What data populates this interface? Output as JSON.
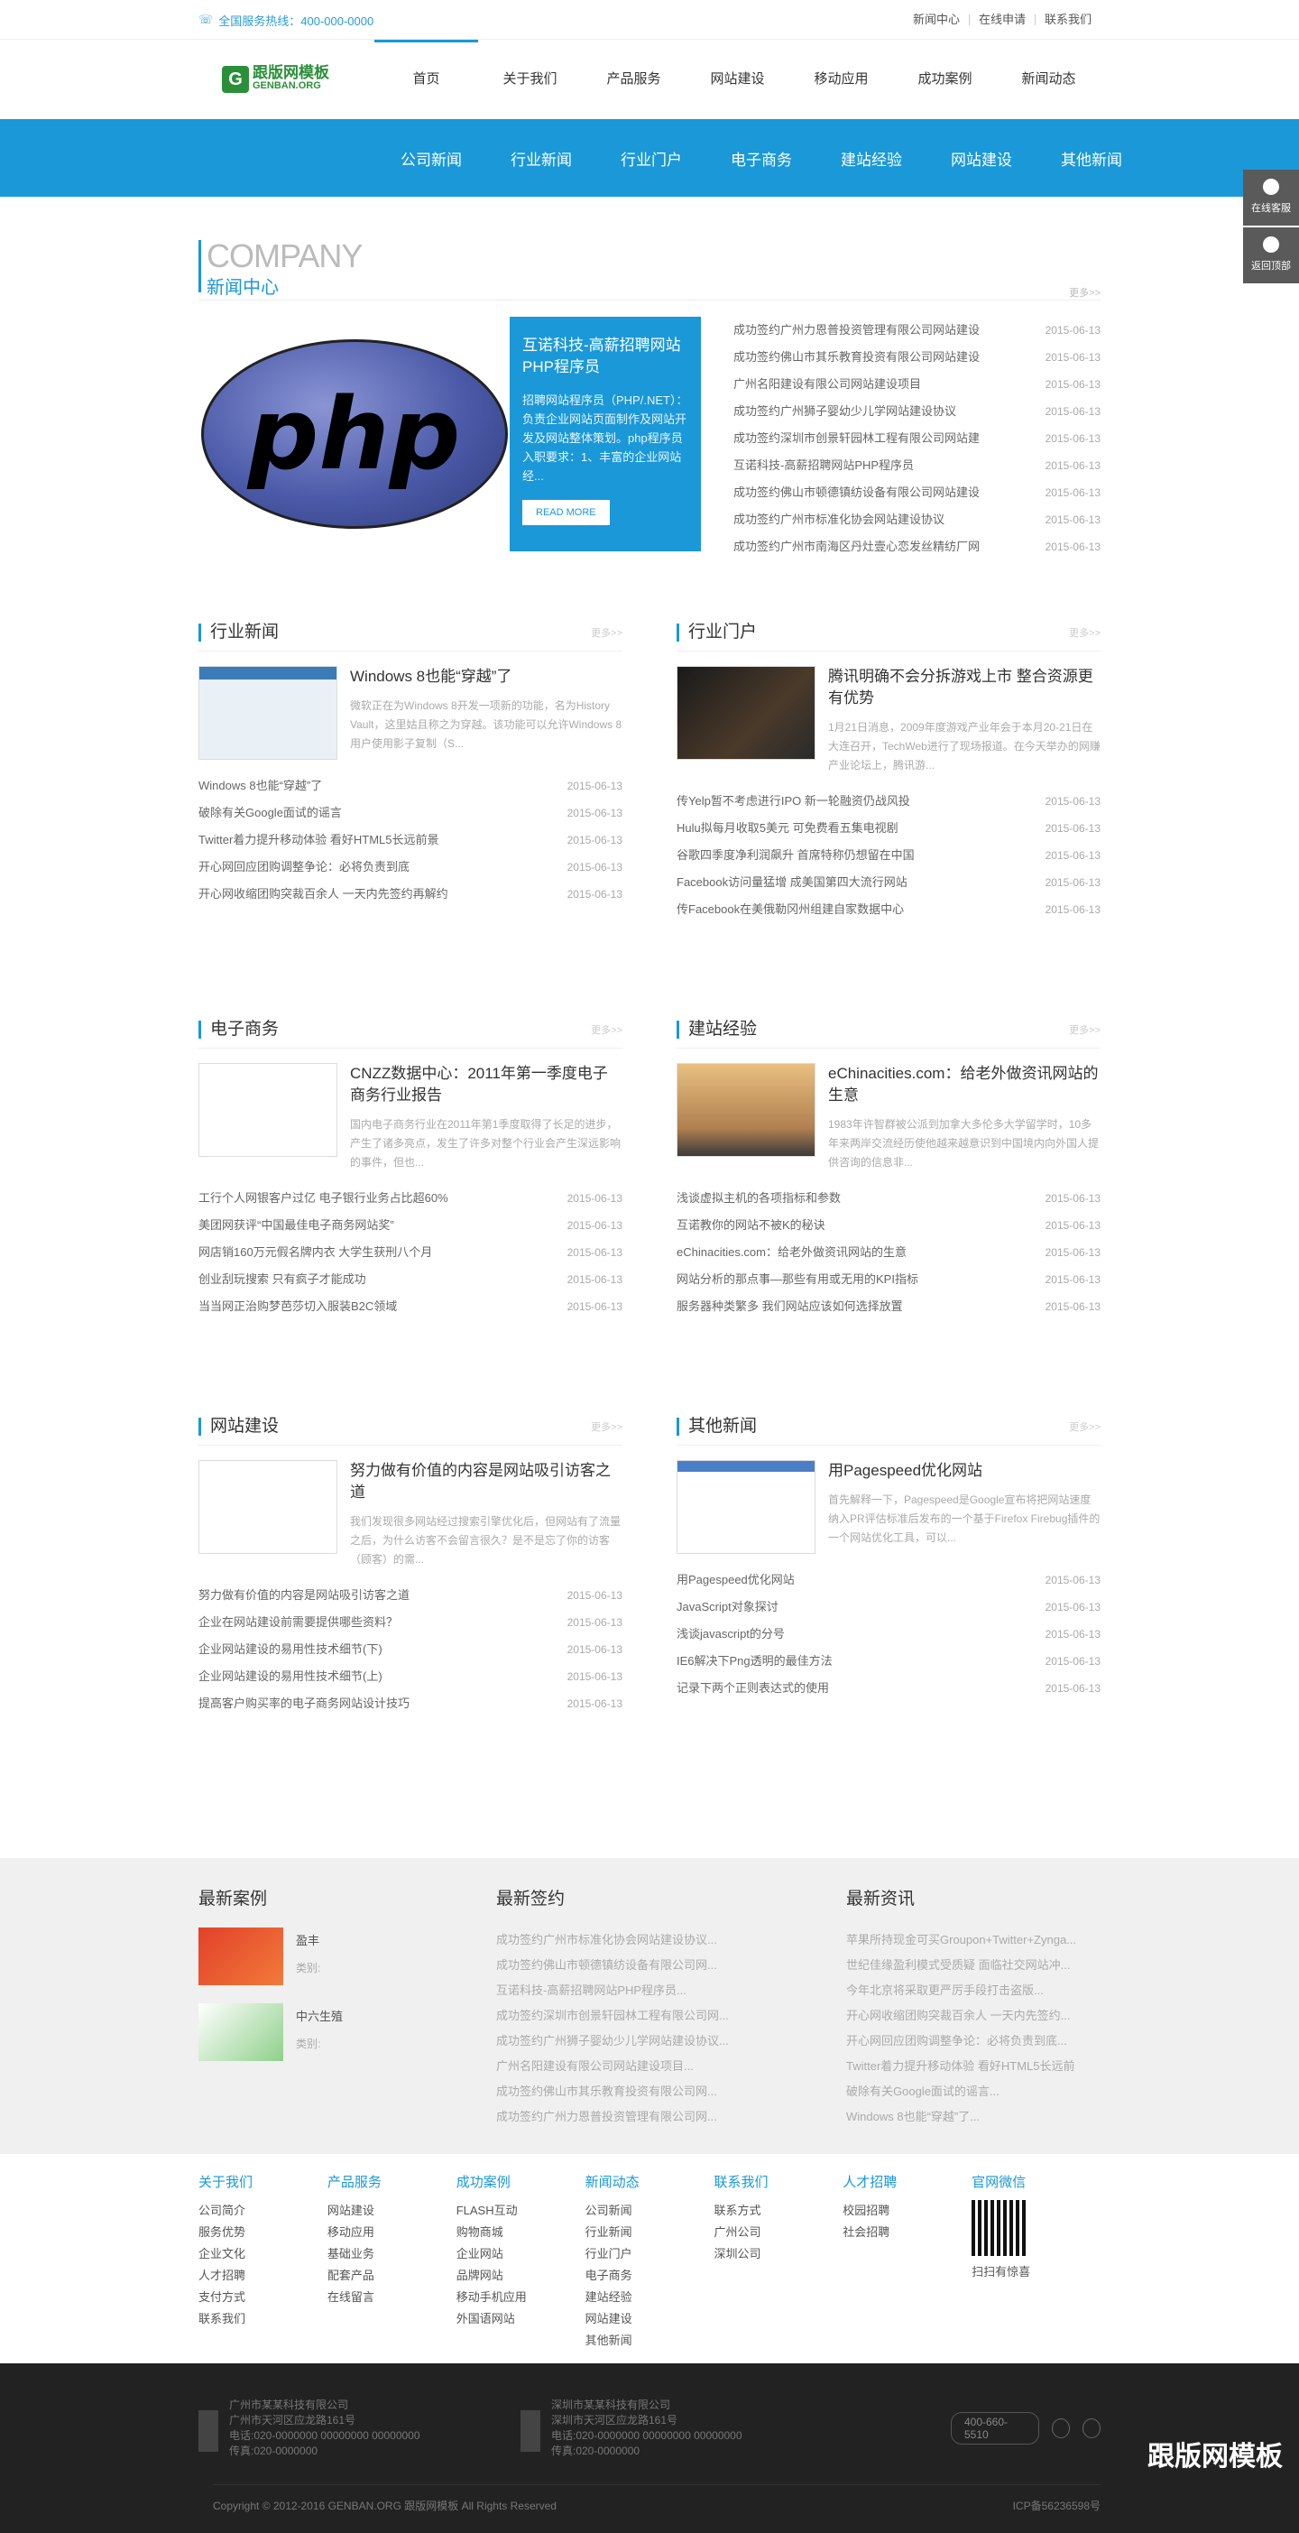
{
  "topbar": {
    "hotline": "全国服务热线：400-000-0000",
    "links": [
      "新闻中心",
      "在线申请",
      "联系我们"
    ]
  },
  "logo": {
    "cn": "跟版网模板",
    "en": "GENBAN.ORG",
    "mark": "G"
  },
  "nav": [
    "首页",
    "关于我们",
    "产品服务",
    "网站建设",
    "移动应用",
    "成功案例",
    "新闻动态"
  ],
  "subnav": [
    "公司新闻",
    "行业新闻",
    "行业门户",
    "电子商务",
    "建站经验",
    "网站建设",
    "其他新闻"
  ],
  "float": [
    "在线客服",
    "返回顶部"
  ],
  "company": {
    "en": "COMPANY",
    "cn": "新闻中心",
    "more": "更多>>",
    "php": "php",
    "feature": {
      "title": "互诺科技-高薪招聘网站PHP程序员",
      "text": "招聘网站程序员（PHP/.NET）：负责企业网站页面制作及网站开发及网站整体策划。php程序员 入职要求：1、丰富的企业网站经...",
      "btn": "READ MORE"
    },
    "list": [
      [
        "成功签约广州力恩普投资管理有限公司网站建设",
        "2015-06-13"
      ],
      [
        "成功签约佛山市其乐教育投资有限公司网站建设",
        "2015-06-13"
      ],
      [
        "广州名阳建设有限公司网站建设项目",
        "2015-06-13"
      ],
      [
        "成功签约广州狮子婴幼少儿学网站建设协议",
        "2015-06-13"
      ],
      [
        "成功签约深圳市创景轩园林工程有限公司网站建",
        "2015-06-13"
      ],
      [
        "互诺科技-高薪招聘网站PHP程序员",
        "2015-06-13"
      ],
      [
        "成功签约佛山市顿德镇纺设备有限公司网站建设",
        "2015-06-13"
      ],
      [
        "成功签约广州市标准化协会网站建设协议",
        "2015-06-13"
      ],
      [
        "成功签约广州市南海区丹灶壹心恋发丝精纺厂网",
        "2015-06-13"
      ]
    ]
  },
  "sections": [
    {
      "title": "行业新闻",
      "more": "更多>>",
      "hero": {
        "title": "Windows 8也能“穿越”了",
        "text": "微软正在为Windows 8开发一项新的功能，名为History Vault，这里姑且称之为穿越。该功能可以允许Windows 8用户使用影子复制（S..."
      },
      "list": [
        [
          "Windows 8也能“穿越”了",
          "2015-06-13"
        ],
        [
          "破除有关Google面试的谣言",
          "2015-06-13"
        ],
        [
          "Twitter着力提升移动体验 看好HTML5长远前景",
          "2015-06-13"
        ],
        [
          "开心网回应团购调整争论：必将负责到底",
          "2015-06-13"
        ],
        [
          "开心网收缩团购突裁百余人 一天内先签约再解约",
          "2015-06-13"
        ]
      ]
    },
    {
      "title": "行业门户",
      "more": "更多>>",
      "hero": {
        "title": "腾讯明确不会分拆游戏上市 整合资源更有优势",
        "text": "1月21日消息，2009年度游戏产业年会于本月20-21日在大连召开，TechWeb进行了现场报道。在今天举办的网赚产业论坛上，腾讯游..."
      },
      "list": [
        [
          "传Yelp暂不考虑进行IPO 新一轮融资仍战风投",
          "2015-06-13"
        ],
        [
          "Hulu拟每月收取5美元 可免费看五集电视剧",
          "2015-06-13"
        ],
        [
          "谷歌四季度净利润飙升 首席特称仍想留在中国",
          "2015-06-13"
        ],
        [
          "Facebook访问量猛增 成美国第四大流行网站",
          "2015-06-13"
        ],
        [
          "传Facebook在美俄勒冈州组建自家数据中心",
          "2015-06-13"
        ]
      ]
    },
    {
      "title": "电子商务",
      "more": "更多>>",
      "hero": {
        "title": "CNZZ数据中心：2011年第一季度电子商务行业报告",
        "text": "国内电子商务行业在2011年第1季度取得了长足的进步，产生了诸多亮点，发生了许多对整个行业会产生深远影响的事件，但也..."
      },
      "list": [
        [
          "工行个人网银客户过亿 电子银行业务占比超60%",
          "2015-06-13"
        ],
        [
          "美团网获评“中国最佳电子商务网站奖”",
          "2015-06-13"
        ],
        [
          "网店销160万元假名牌内衣 大学生获刑八个月",
          "2015-06-13"
        ],
        [
          "创业刮玩搜索 只有疯子才能成功",
          "2015-06-13"
        ],
        [
          "当当网正治购梦芭莎切入服装B2C领域",
          "2015-06-13"
        ]
      ]
    },
    {
      "title": "建站经验",
      "more": "更多>>",
      "hero": {
        "title": "eChinacities.com：给老外做资讯网站的生意",
        "text": "1983年许智群被公派到加拿大多伦多大学留学时，10多年来两岸交流经历使他越来越意识到中国境内向外国人提供咨询的信息非..."
      },
      "list": [
        [
          "浅谈虚拟主机的各项指标和参数",
          "2015-06-13"
        ],
        [
          "互诺教你的网站不被K的秘诀",
          "2015-06-13"
        ],
        [
          "eChinacities.com：给老外做资讯网站的生意",
          "2015-06-13"
        ],
        [
          "网站分析的那点事—那些有用或无用的KPI指标",
          "2015-06-13"
        ],
        [
          "服务器种类繁多 我们网站应该如何选择放置",
          "2015-06-13"
        ]
      ]
    },
    {
      "title": "网站建设",
      "more": "更多>>",
      "hero": {
        "title": "努力做有价值的内容是网站吸引访客之道",
        "text": "我们发现很多网站经过搜索引擎优化后，但网站有了流量之后，为什么访客不会留言很久？是不是忘了你的访客（顾客）的需..."
      },
      "list": [
        [
          "努力做有价值的内容是网站吸引访客之道",
          "2015-06-13"
        ],
        [
          "企业在网站建设前需要提供哪些资料？",
          "2015-06-13"
        ],
        [
          "企业网站建设的易用性技术细节(下)",
          "2015-06-13"
        ],
        [
          "企业网站建设的易用性技术细节(上)",
          "2015-06-13"
        ],
        [
          "提高客户购买率的电子商务网站设计技巧",
          "2015-06-13"
        ]
      ]
    },
    {
      "title": "其他新闻",
      "more": "更多>>",
      "hero": {
        "title": "用Pagespeed优化网站",
        "text": "首先解释一下，Pagespeed是Google宣布将把网站速度纳入PR评估标准后发布的一个基于Firefox Firebug插件的一个网站优化工具，可以..."
      },
      "list": [
        [
          "用Pagespeed优化网站",
          "2015-06-13"
        ],
        [
          "JavaScript对象探讨",
          "2015-06-13"
        ],
        [
          "浅谈javascript的分号",
          "2015-06-13"
        ],
        [
          "IE6解决下Png透明的最佳方法",
          "2015-06-13"
        ],
        [
          "记录下两个正则表达式的使用",
          "2015-06-13"
        ]
      ]
    }
  ],
  "footer": {
    "cases_title": "最新案例",
    "cases": [
      {
        "name": "盈丰",
        "type": "类别:"
      },
      {
        "name": "中六生殖",
        "type": "类别:"
      }
    ],
    "sign_title": "最新签约",
    "sign": [
      "成功签约广州市标准化协会网站建设协议...",
      "成功签约佛山市顿德镇纺设备有限公司网...",
      "互诺科技-高薪招聘网站PHP程序员...",
      "成功签约深圳市创景轩园林工程有限公司网...",
      "成功签约广州狮子婴幼少儿学网站建设协议...",
      "广州名阳建设有限公司网站建设项目...",
      "成功签约佛山市其乐教育投资有限公司网...",
      "成功签约广州力恩普投资管理有限公司网..."
    ],
    "info_title": "最新资讯",
    "info": [
      "苹果所持现金可买Groupon+Twitter+Zynga...",
      "世纪佳缘盈利模式受质疑 面临社交网站冲...",
      "今年北京将采取更严厉手段打击盗版...",
      "开心网收缩团购突裁百余人 一天内先签约...",
      "开心网回应团购调整争论：必将负责到底...",
      "Twitter着力提升移动体验 看好HTML5长远前",
      "破除有关Google面试的谣言...",
      "Windows 8也能“穿越”了..."
    ],
    "cols": [
      {
        "h": "关于我们",
        "items": [
          "公司简介",
          "服务优势",
          "企业文化",
          "人才招聘",
          "支付方式",
          "联系我们"
        ]
      },
      {
        "h": "产品服务",
        "items": [
          "网站建设",
          "移动应用",
          "基础业务",
          "配套产品",
          "在线留言"
        ]
      },
      {
        "h": "成功案例",
        "items": [
          "FLASH互动",
          "购物商城",
          "企业网站",
          "品牌网站",
          "移动手机应用",
          "外国语网站"
        ]
      },
      {
        "h": "新闻动态",
        "items": [
          "公司新闻",
          "行业新闻",
          "行业门户",
          "电子商务",
          "建站经验",
          "网站建设",
          "其他新闻"
        ]
      },
      {
        "h": "联系我们",
        "items": [
          "联系方式",
          "广州公司",
          "深圳公司"
        ]
      },
      {
        "h": "人才招聘",
        "items": [
          "校园招聘",
          "社会招聘"
        ]
      },
      {
        "h": "官网微信",
        "items": [
          "扫扫有惊喜"
        ]
      }
    ],
    "addr1": [
      "广州市某某科技有限公司",
      "广州市天河区应龙路161号",
      "电话:020-0000000 00000000 00000000",
      "传真:020-0000000"
    ],
    "addr2": [
      "深圳市某某科技有限公司",
      "深圳市天河区应龙路161号",
      "电话:020-0000000 00000000 00000000",
      "传真:020-0000000"
    ],
    "phone": "400-660-5510",
    "copyright": "Copyright © 2012-2016 GENBAN.ORG 跟版网模板 All Rights Reserved",
    "icp": "ICP备56236598号",
    "watermark": "跟版网模板"
  }
}
